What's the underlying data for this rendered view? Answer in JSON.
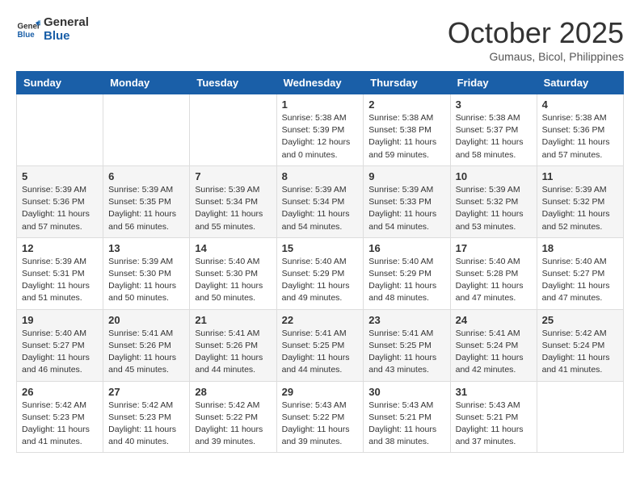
{
  "logo": {
    "line1": "General",
    "line2": "Blue"
  },
  "title": "October 2025",
  "subtitle": "Gumaus, Bicol, Philippines",
  "weekdays": [
    "Sunday",
    "Monday",
    "Tuesday",
    "Wednesday",
    "Thursday",
    "Friday",
    "Saturday"
  ],
  "weeks": [
    [
      {
        "day": "",
        "info": ""
      },
      {
        "day": "",
        "info": ""
      },
      {
        "day": "",
        "info": ""
      },
      {
        "day": "1",
        "info": "Sunrise: 5:38 AM\nSunset: 5:39 PM\nDaylight: 12 hours\nand 0 minutes."
      },
      {
        "day": "2",
        "info": "Sunrise: 5:38 AM\nSunset: 5:38 PM\nDaylight: 11 hours\nand 59 minutes."
      },
      {
        "day": "3",
        "info": "Sunrise: 5:38 AM\nSunset: 5:37 PM\nDaylight: 11 hours\nand 58 minutes."
      },
      {
        "day": "4",
        "info": "Sunrise: 5:38 AM\nSunset: 5:36 PM\nDaylight: 11 hours\nand 57 minutes."
      }
    ],
    [
      {
        "day": "5",
        "info": "Sunrise: 5:39 AM\nSunset: 5:36 PM\nDaylight: 11 hours\nand 57 minutes."
      },
      {
        "day": "6",
        "info": "Sunrise: 5:39 AM\nSunset: 5:35 PM\nDaylight: 11 hours\nand 56 minutes."
      },
      {
        "day": "7",
        "info": "Sunrise: 5:39 AM\nSunset: 5:34 PM\nDaylight: 11 hours\nand 55 minutes."
      },
      {
        "day": "8",
        "info": "Sunrise: 5:39 AM\nSunset: 5:34 PM\nDaylight: 11 hours\nand 54 minutes."
      },
      {
        "day": "9",
        "info": "Sunrise: 5:39 AM\nSunset: 5:33 PM\nDaylight: 11 hours\nand 54 minutes."
      },
      {
        "day": "10",
        "info": "Sunrise: 5:39 AM\nSunset: 5:32 PM\nDaylight: 11 hours\nand 53 minutes."
      },
      {
        "day": "11",
        "info": "Sunrise: 5:39 AM\nSunset: 5:32 PM\nDaylight: 11 hours\nand 52 minutes."
      }
    ],
    [
      {
        "day": "12",
        "info": "Sunrise: 5:39 AM\nSunset: 5:31 PM\nDaylight: 11 hours\nand 51 minutes."
      },
      {
        "day": "13",
        "info": "Sunrise: 5:39 AM\nSunset: 5:30 PM\nDaylight: 11 hours\nand 50 minutes."
      },
      {
        "day": "14",
        "info": "Sunrise: 5:40 AM\nSunset: 5:30 PM\nDaylight: 11 hours\nand 50 minutes."
      },
      {
        "day": "15",
        "info": "Sunrise: 5:40 AM\nSunset: 5:29 PM\nDaylight: 11 hours\nand 49 minutes."
      },
      {
        "day": "16",
        "info": "Sunrise: 5:40 AM\nSunset: 5:29 PM\nDaylight: 11 hours\nand 48 minutes."
      },
      {
        "day": "17",
        "info": "Sunrise: 5:40 AM\nSunset: 5:28 PM\nDaylight: 11 hours\nand 47 minutes."
      },
      {
        "day": "18",
        "info": "Sunrise: 5:40 AM\nSunset: 5:27 PM\nDaylight: 11 hours\nand 47 minutes."
      }
    ],
    [
      {
        "day": "19",
        "info": "Sunrise: 5:40 AM\nSunset: 5:27 PM\nDaylight: 11 hours\nand 46 minutes."
      },
      {
        "day": "20",
        "info": "Sunrise: 5:41 AM\nSunset: 5:26 PM\nDaylight: 11 hours\nand 45 minutes."
      },
      {
        "day": "21",
        "info": "Sunrise: 5:41 AM\nSunset: 5:26 PM\nDaylight: 11 hours\nand 44 minutes."
      },
      {
        "day": "22",
        "info": "Sunrise: 5:41 AM\nSunset: 5:25 PM\nDaylight: 11 hours\nand 44 minutes."
      },
      {
        "day": "23",
        "info": "Sunrise: 5:41 AM\nSunset: 5:25 PM\nDaylight: 11 hours\nand 43 minutes."
      },
      {
        "day": "24",
        "info": "Sunrise: 5:41 AM\nSunset: 5:24 PM\nDaylight: 11 hours\nand 42 minutes."
      },
      {
        "day": "25",
        "info": "Sunrise: 5:42 AM\nSunset: 5:24 PM\nDaylight: 11 hours\nand 41 minutes."
      }
    ],
    [
      {
        "day": "26",
        "info": "Sunrise: 5:42 AM\nSunset: 5:23 PM\nDaylight: 11 hours\nand 41 minutes."
      },
      {
        "day": "27",
        "info": "Sunrise: 5:42 AM\nSunset: 5:23 PM\nDaylight: 11 hours\nand 40 minutes."
      },
      {
        "day": "28",
        "info": "Sunrise: 5:42 AM\nSunset: 5:22 PM\nDaylight: 11 hours\nand 39 minutes."
      },
      {
        "day": "29",
        "info": "Sunrise: 5:43 AM\nSunset: 5:22 PM\nDaylight: 11 hours\nand 39 minutes."
      },
      {
        "day": "30",
        "info": "Sunrise: 5:43 AM\nSunset: 5:21 PM\nDaylight: 11 hours\nand 38 minutes."
      },
      {
        "day": "31",
        "info": "Sunrise: 5:43 AM\nSunset: 5:21 PM\nDaylight: 11 hours\nand 37 minutes."
      },
      {
        "day": "",
        "info": ""
      }
    ]
  ]
}
